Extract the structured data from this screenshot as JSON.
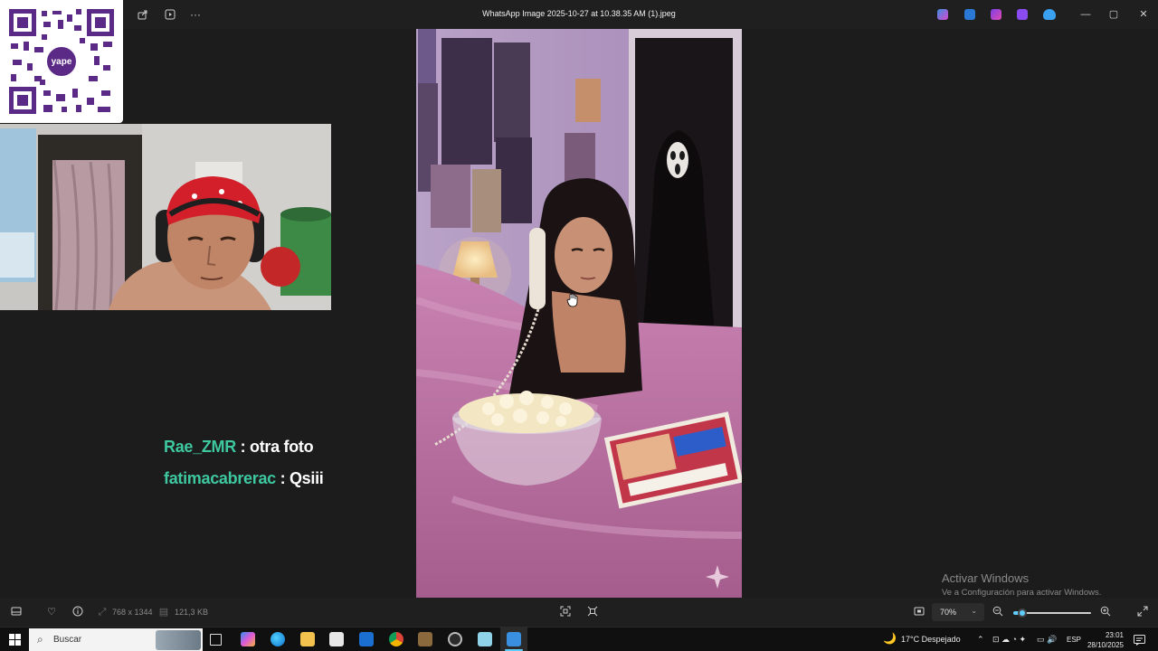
{
  "window": {
    "title": "WhatsApp Image 2025-10-27 at 10.38.35 AM (1).jpeg",
    "toolbar_icons": [
      "share-icon",
      "slideshow-icon",
      "more-icon"
    ],
    "app_icons": [
      "copilot-icon",
      "edit-icon",
      "designer-icon",
      "clipchamp-icon",
      "onedrive-icon"
    ],
    "controls": [
      "minimize-icon",
      "restore-icon",
      "close-icon"
    ]
  },
  "qr": {
    "logo_text": "yape"
  },
  "chat": [
    {
      "user": "Rae_ZMR",
      "separator": " : ",
      "message": "otra foto"
    },
    {
      "user": "fatimacabrerac",
      "separator": " : ",
      "message": "Qsiii"
    }
  ],
  "watermark": {
    "title": "Activar Windows",
    "subtitle": "Ve a Configuración para activar Windows."
  },
  "bottom": {
    "dimensions": "768 x 1344",
    "file_size": "121,3 KB",
    "zoom": "70%",
    "zoom_level": 0.12
  },
  "taskbar": {
    "search_placeholder": "Buscar",
    "weather": "17°C  Despejado",
    "language": "ESP",
    "time": "23:01",
    "date": "28/10/2025"
  },
  "colors": {
    "chat_user": "#3ec8a0",
    "accent": "#60cdff",
    "background": "#1c1c1c"
  }
}
